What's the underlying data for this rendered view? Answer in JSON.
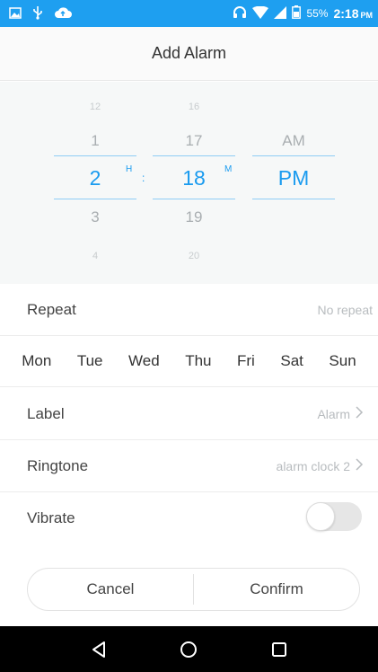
{
  "status_bar": {
    "battery_percent": "55%",
    "time": "2:18",
    "ampm": "PM",
    "icons": [
      "image-icon",
      "usb-icon",
      "cloud-upload-icon",
      "headset-icon",
      "wifi-icon",
      "signal-icon",
      "battery-icon"
    ]
  },
  "header": {
    "title": "Add Alarm"
  },
  "picker": {
    "hours": {
      "far_above": "12",
      "above": "1",
      "selected": "2",
      "below": "3",
      "far_below": "4",
      "unit": "H"
    },
    "separator": ":",
    "minutes": {
      "far_above": "16",
      "above": "17",
      "selected": "18",
      "below": "19",
      "far_below": "20",
      "unit": "M"
    },
    "period": {
      "above": "AM",
      "selected": "PM"
    },
    "accent_color": "#1a9bef"
  },
  "repeat": {
    "label": "Repeat",
    "value": "No repeat"
  },
  "days": [
    "Mon",
    "Tue",
    "Wed",
    "Thu",
    "Fri",
    "Sat",
    "Sun"
  ],
  "label_row": {
    "label": "Label",
    "value": "Alarm"
  },
  "ringtone_row": {
    "label": "Ringtone",
    "value": "alarm clock 2"
  },
  "vibrate_row": {
    "label": "Vibrate",
    "enabled": false
  },
  "buttons": {
    "cancel": "Cancel",
    "confirm": "Confirm"
  },
  "nav": {
    "icons": [
      "back-icon",
      "home-icon",
      "recents-icon"
    ]
  }
}
